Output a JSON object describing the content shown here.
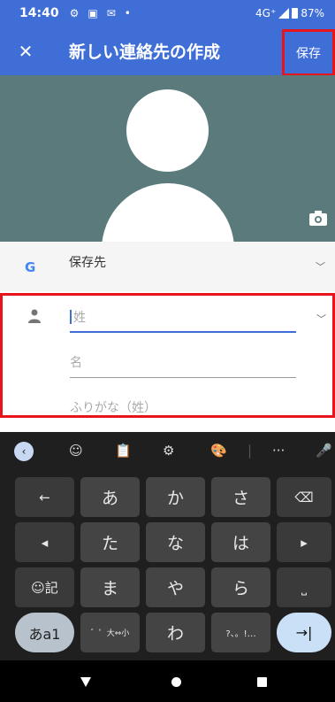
{
  "status": {
    "time": "14:40",
    "icons": [
      "⚙",
      "▣",
      "✉",
      "•"
    ],
    "network": "4G⁺",
    "battery": "87%"
  },
  "appbar": {
    "close": "✕",
    "title": "新しい連絡先の作成",
    "save": "保存"
  },
  "account": {
    "logo": "G",
    "label": "保存先"
  },
  "fields": [
    {
      "placeholder": "姓"
    },
    {
      "placeholder": "名"
    },
    {
      "placeholder": "ふりがな（姓）"
    }
  ],
  "keyboard": {
    "toolbar": [
      "‹",
      "☺",
      "📋",
      "⚙",
      "🎨",
      "|",
      "···",
      "🎤"
    ],
    "rows": [
      [
        "←",
        "あ",
        "か",
        "さ",
        "⌫"
      ],
      [
        "◂",
        "た",
        "な",
        "は",
        "▸"
      ],
      [
        "☺記",
        "ま",
        "や",
        "ら",
        "⎵"
      ],
      [
        "あa1",
        "゛゜大⇔小",
        "わ",
        "?、。!…",
        "→|"
      ]
    ]
  },
  "colors": {
    "accent": "#3f6ed6",
    "highlight": "#e8141c",
    "hero": "#5b7a7c"
  }
}
